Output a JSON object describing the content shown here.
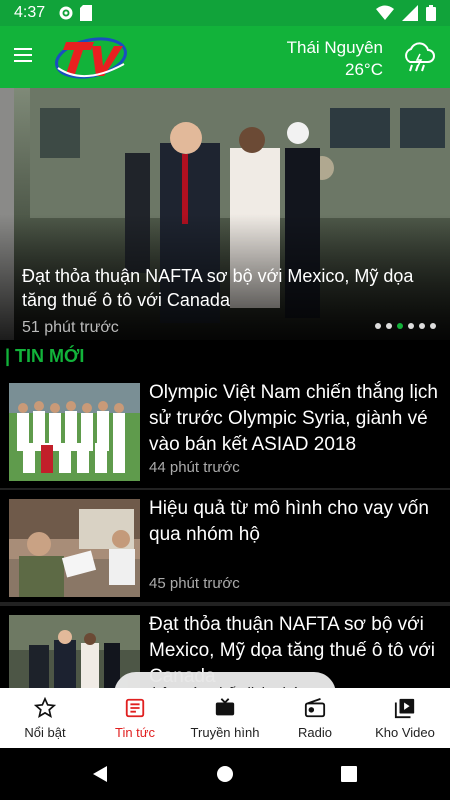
{
  "status_bar": {
    "time": "4:37"
  },
  "header": {
    "city": "Thái Nguyên",
    "temperature": "26°C",
    "weather_icon": "rain-cloud-icon"
  },
  "hero": {
    "title": "Đạt thỏa thuận NAFTA sơ bộ với Mexico, Mỹ dọa tăng thuế ô tô với Canada",
    "time": "51 phút trước",
    "slides": 6,
    "active_slide": 3
  },
  "section": {
    "title": "| TIN MỚI"
  },
  "news": [
    {
      "title": "Olympic Việt Nam chiến thắng lịch sử trước Olympic Syria, giành vé vào bán kết ASIAD 2018",
      "time": "44 phút trước"
    },
    {
      "title": "Hiệu quả từ mô hình cho vay vốn qua nhóm hộ",
      "time": "45 phút trước"
    },
    {
      "title": "Đạt thỏa thuận NAFTA sơ bộ với Mexico, Mỹ dọa tăng thuế ô tô với Canada",
      "time": ""
    }
  ],
  "toast": {
    "message": "Không tìm thấy lịch phát!"
  },
  "bottom_nav": [
    {
      "label": "Nổi bật",
      "icon": "star-icon"
    },
    {
      "label": "Tin tức",
      "icon": "news-icon"
    },
    {
      "label": "Truyền hình",
      "icon": "tv-icon"
    },
    {
      "label": "Radio",
      "icon": "radio-icon"
    },
    {
      "label": "Kho Video",
      "icon": "video-library-icon"
    }
  ],
  "colors": {
    "brand_green": "#12b33a",
    "active_tab": "#e02020"
  }
}
